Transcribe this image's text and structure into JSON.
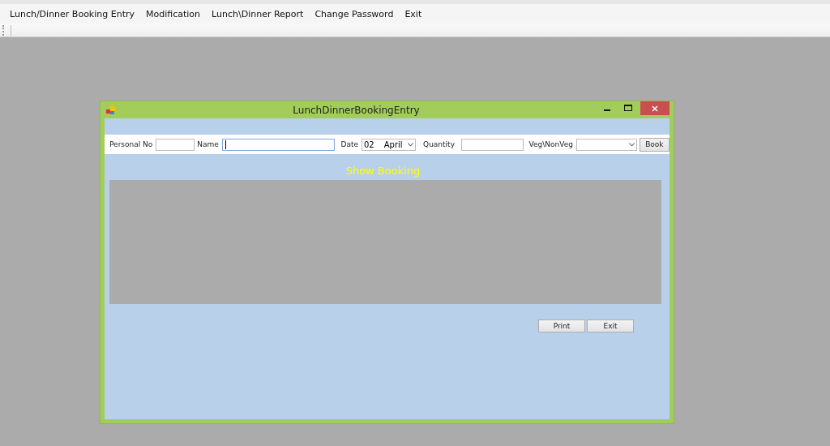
{
  "menu": [
    "Lunch/Dinner Booking Entry",
    "Modification",
    "Lunch\\Dinner Report",
    "Change Password",
    "Exit"
  ],
  "window": {
    "title": "LunchDinnerBookingEntry"
  },
  "form": {
    "personal_no_label": "Personal No",
    "name_label": "Name",
    "date_label": "Date",
    "date_day": "02",
    "date_month": "April",
    "quantity_label": "Quantity",
    "veg_label": "Veg\\NonVeg",
    "book_button": "Book"
  },
  "heading": "Show Booking",
  "buttons": [
    "Print",
    "Exit"
  ]
}
